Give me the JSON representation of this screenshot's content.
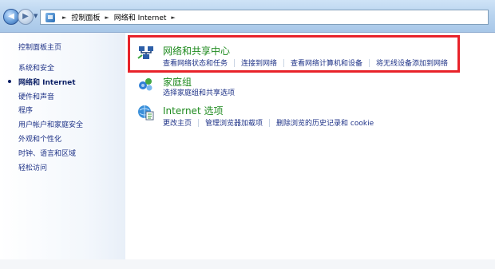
{
  "address_bar": {
    "crumbs": [
      "控制面板",
      "网络和 Internet"
    ]
  },
  "sidebar": {
    "home": "控制面板主页",
    "items": [
      {
        "label": "系统和安全",
        "current": false
      },
      {
        "label": "网络和 Internet",
        "current": true
      },
      {
        "label": "硬件和声音",
        "current": false
      },
      {
        "label": "程序",
        "current": false
      },
      {
        "label": "用户帐户和家庭安全",
        "current": false
      },
      {
        "label": "外观和个性化",
        "current": false
      },
      {
        "label": "时钟、语言和区域",
        "current": false
      },
      {
        "label": "轻松访问",
        "current": false
      }
    ]
  },
  "categories": [
    {
      "title": "网络和共享中心",
      "icon": "network-sharing-center-icon",
      "links": [
        "查看网络状态和任务",
        "连接到网络",
        "查看网络计算机和设备",
        "将无线设备添加到网络"
      ]
    },
    {
      "title": "家庭组",
      "icon": "homegroup-icon",
      "links": [
        "选择家庭组和共享选项"
      ]
    },
    {
      "title": "Internet 选项",
      "icon": "internet-options-icon",
      "links": [
        "更改主页",
        "管理浏览器加载项",
        "删除浏览的历史记录和 cookie"
      ]
    }
  ],
  "colors": {
    "category_title": "#1e8a1e",
    "link": "#1e3287",
    "highlight_box": "#e8232a"
  }
}
